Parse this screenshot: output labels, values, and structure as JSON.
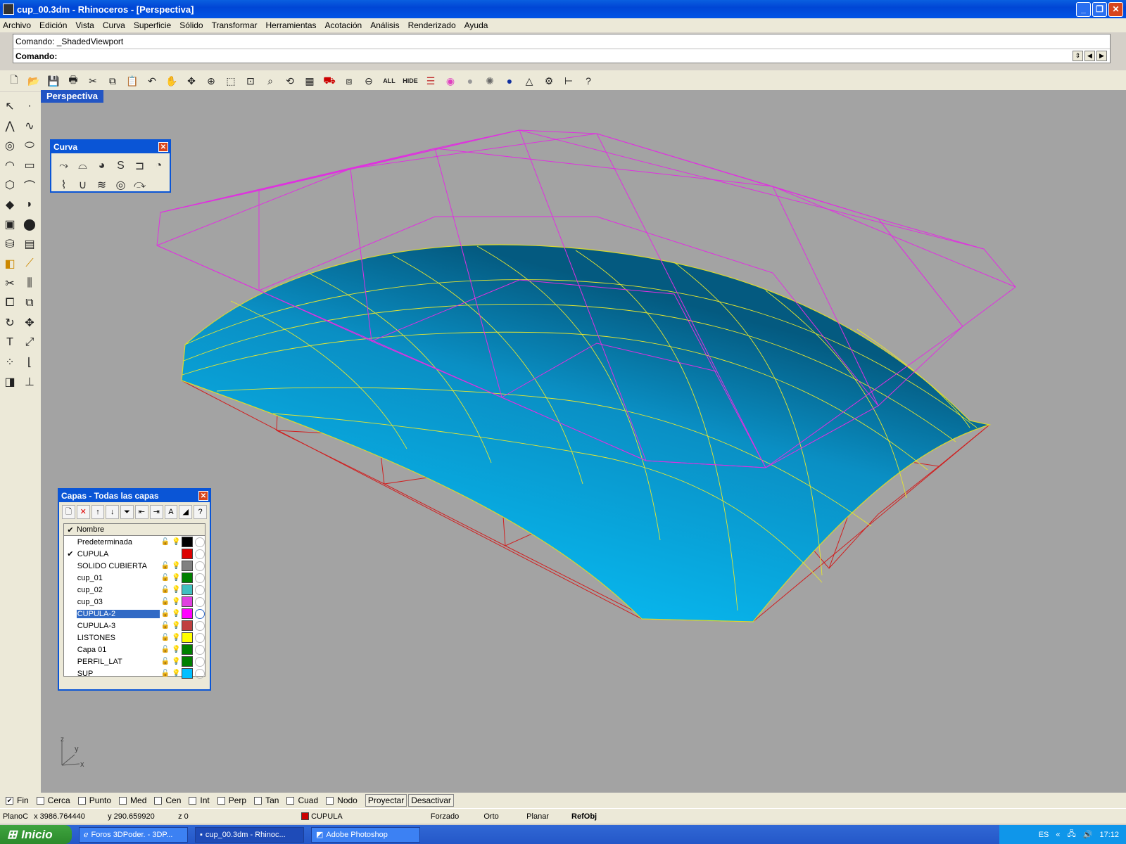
{
  "window": {
    "title": "cup_00.3dm - Rhinoceros - [Perspectiva]",
    "buttons": [
      "_",
      "❐",
      "✕"
    ]
  },
  "menu": [
    "Archivo",
    "Edición",
    "Vista",
    "Curva",
    "Superficie",
    "Sólido",
    "Transformar",
    "Herramientas",
    "Acotación",
    "Análisis",
    "Renderizado",
    "Ayuda"
  ],
  "command": {
    "history": "Comando: _ShadedViewport",
    "prompt": "Comando:",
    "value": ""
  },
  "toolbar_text": {
    "all": "ALL",
    "hide": "HIDE"
  },
  "viewport": {
    "title": "Perspectiva",
    "axis": {
      "z": "z",
      "y": "y",
      "x": "x"
    }
  },
  "curva_panel": {
    "title": "Curva"
  },
  "layers_panel": {
    "title": "Capas - Todas las capas",
    "column_header": "Nombre",
    "layers": [
      {
        "name": "Predeterminada",
        "color": "#000000",
        "current": false,
        "selected": false
      },
      {
        "name": "CUPULA",
        "color": "#dd0000",
        "current": true,
        "selected": false
      },
      {
        "name": "SOLIDO CUBIERTA",
        "color": "#808080",
        "current": false,
        "selected": false
      },
      {
        "name": "cup_01",
        "color": "#008000",
        "current": false,
        "selected": false
      },
      {
        "name": "cup_02",
        "color": "#40c0c0",
        "current": false,
        "selected": false
      },
      {
        "name": "cup_03",
        "color": "#e040e0",
        "current": false,
        "selected": false
      },
      {
        "name": "CUPULA-2",
        "color": "#ff00ff",
        "current": false,
        "selected": true
      },
      {
        "name": "CUPULA-3",
        "color": "#c04040",
        "current": false,
        "selected": false
      },
      {
        "name": "LISTONES",
        "color": "#ffff00",
        "current": false,
        "selected": false
      },
      {
        "name": "Capa 01",
        "color": "#008000",
        "current": false,
        "selected": false
      },
      {
        "name": "PERFIL_LAT",
        "color": "#008000",
        "current": false,
        "selected": false
      },
      {
        "name": "SUP",
        "color": "#00bfff",
        "current": false,
        "selected": false
      }
    ]
  },
  "snaps": [
    {
      "label": "Fin",
      "checked": true
    },
    {
      "label": "Cerca",
      "checked": false
    },
    {
      "label": "Punto",
      "checked": false
    },
    {
      "label": "Med",
      "checked": false
    },
    {
      "label": "Cen",
      "checked": false
    },
    {
      "label": "Int",
      "checked": false
    },
    {
      "label": "Perp",
      "checked": false
    },
    {
      "label": "Tan",
      "checked": false
    },
    {
      "label": "Cuad",
      "checked": false
    },
    {
      "label": "Nodo",
      "checked": false
    }
  ],
  "snap_buttons": [
    "Proyectar",
    "Desactivar"
  ],
  "status": {
    "plane": "PlanoC",
    "x": "x 3986.764440",
    "y": "y 290.659920",
    "z": "z 0",
    "layer": "CUPULA",
    "modes": [
      "Forzado",
      "Orto",
      "Planar",
      "RefObj"
    ]
  },
  "taskbar": {
    "start": "Inicio",
    "tasks": [
      "Foros 3DPoder. - 3DP...",
      "cup_00.3dm - Rhinoc...",
      "Adobe Photoshop"
    ],
    "lang": "ES",
    "time": "17:12"
  }
}
